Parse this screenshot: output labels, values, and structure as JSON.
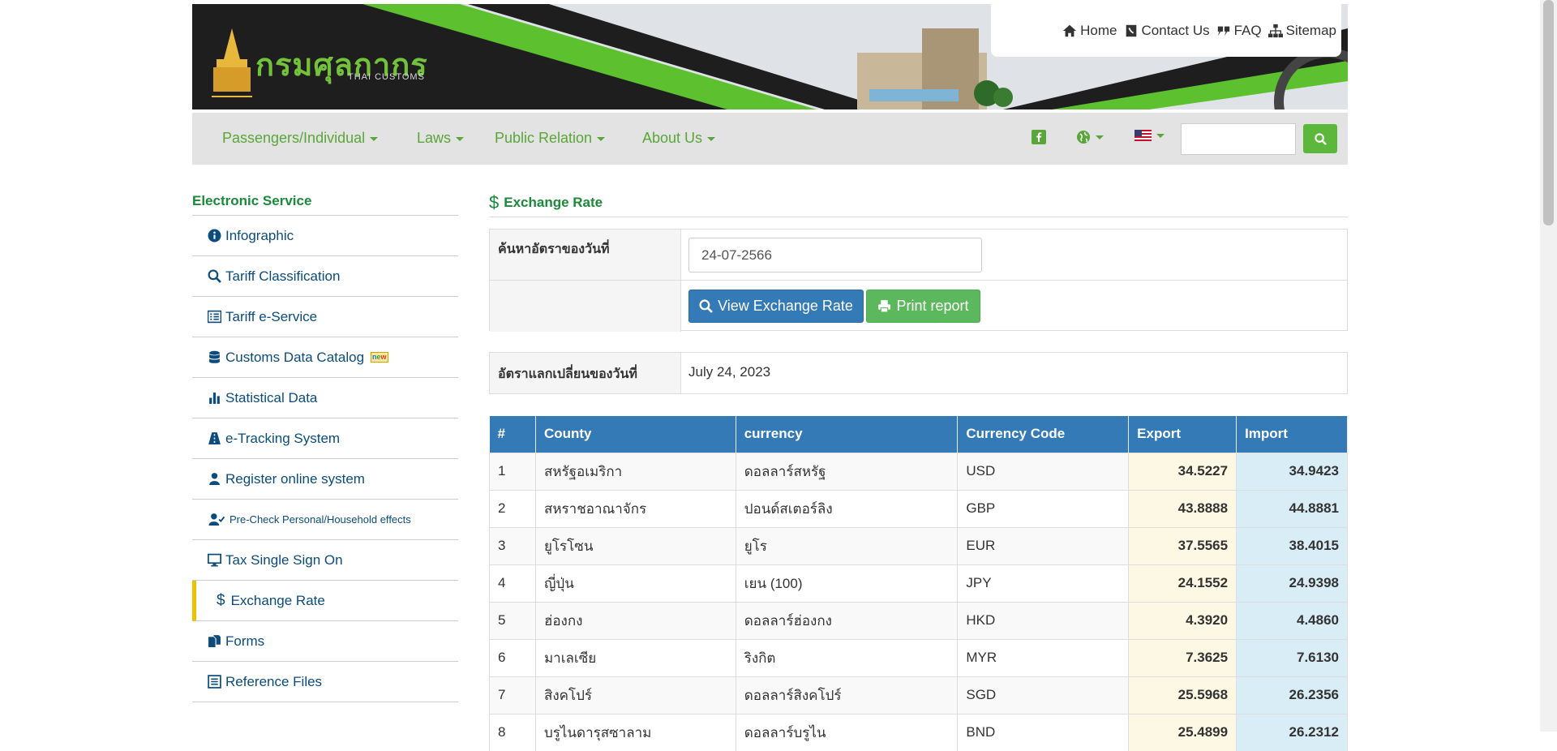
{
  "header": {
    "logo_th": "กรมศุลกากร",
    "logo_en": "THAI CUSTOMS",
    "links": [
      {
        "label": "Home",
        "icon": "home-icon"
      },
      {
        "label": "Contact Us",
        "icon": "phone-book-icon"
      },
      {
        "label": "FAQ",
        "icon": "quote-icon"
      },
      {
        "label": "Sitemap",
        "icon": "sitemap-icon"
      }
    ]
  },
  "nav": {
    "items": [
      "Passengers/Individual",
      "Laws",
      "Public Relation",
      "About Us"
    ],
    "search_placeholder": ""
  },
  "sidebar": {
    "title": "Electronic Service",
    "items": [
      {
        "label": "Infographic",
        "icon": "info-circle-icon"
      },
      {
        "label": "Tariff Classification",
        "icon": "search-icon"
      },
      {
        "label": "Tariff e-Service",
        "icon": "list-table-icon"
      },
      {
        "label": "Customs Data Catalog",
        "icon": "database-icon",
        "badge": "new"
      },
      {
        "label": "Statistical Data",
        "icon": "bar-chart-icon"
      },
      {
        "label": "e-Tracking System",
        "icon": "road-icon"
      },
      {
        "label": "Register online system",
        "icon": "user-icon"
      },
      {
        "label": "Pre-Check Personal/Household effects",
        "icon": "user-check-icon"
      },
      {
        "label": "Tax Single Sign On",
        "icon": "monitor-icon"
      },
      {
        "label": "Exchange Rate",
        "icon": "dollar-icon",
        "active": true
      },
      {
        "label": "Forms",
        "icon": "documents-icon"
      },
      {
        "label": "Reference Files",
        "icon": "file-list-icon"
      }
    ]
  },
  "main": {
    "title": "Exchange Rate",
    "search_label": "ค้นหาอัตราของวันที่",
    "date_value": "24-07-2566",
    "view_button": "View Exchange Rate",
    "print_button": "Print report",
    "rate_date_label": "อัตราแลกเปลี่ยนของวันที่",
    "rate_date_value": "July 24, 2023",
    "table": {
      "headers": [
        "#",
        "County",
        "currency",
        "Currency Code",
        "Export",
        "Import"
      ],
      "rows": [
        [
          "1",
          "สหรัฐอเมริกา",
          "ดอลลาร์สหรัฐ",
          "USD",
          "34.5227",
          "34.9423"
        ],
        [
          "2",
          "สหราชอาณาจักร",
          "ปอนด์สเตอร์ลิง",
          "GBP",
          "43.8888",
          "44.8881"
        ],
        [
          "3",
          "ยูโรโซน",
          "ยูโร",
          "EUR",
          "37.5565",
          "38.4015"
        ],
        [
          "4",
          "ญี่ปุ่น",
          "เยน (100)",
          "JPY",
          "24.1552",
          "24.9398"
        ],
        [
          "5",
          "ฮ่องกง",
          "ดอลลาร์ฮ่องกง",
          "HKD",
          "4.3920",
          "4.4860"
        ],
        [
          "6",
          "มาเลเซีย",
          "ริงกิต",
          "MYR",
          "7.3625",
          "7.6130"
        ],
        [
          "7",
          "สิงคโปร์",
          "ดอลลาร์สิงคโปร์",
          "SGD",
          "25.5968",
          "26.2356"
        ],
        [
          "8",
          "บรูไนดารุสซาลาม",
          "ดอลลาร์บรูไน",
          "BND",
          "25.4899",
          "26.2312"
        ]
      ]
    }
  },
  "colors": {
    "brand_green": "#5aa63a",
    "title_green": "#1a8a3a",
    "link_blue": "#0b4c7c",
    "header_blue": "#337ab7",
    "export_bg": "#fcf8e3",
    "import_bg": "#d9edf7",
    "active_marker": "#f0c000"
  }
}
